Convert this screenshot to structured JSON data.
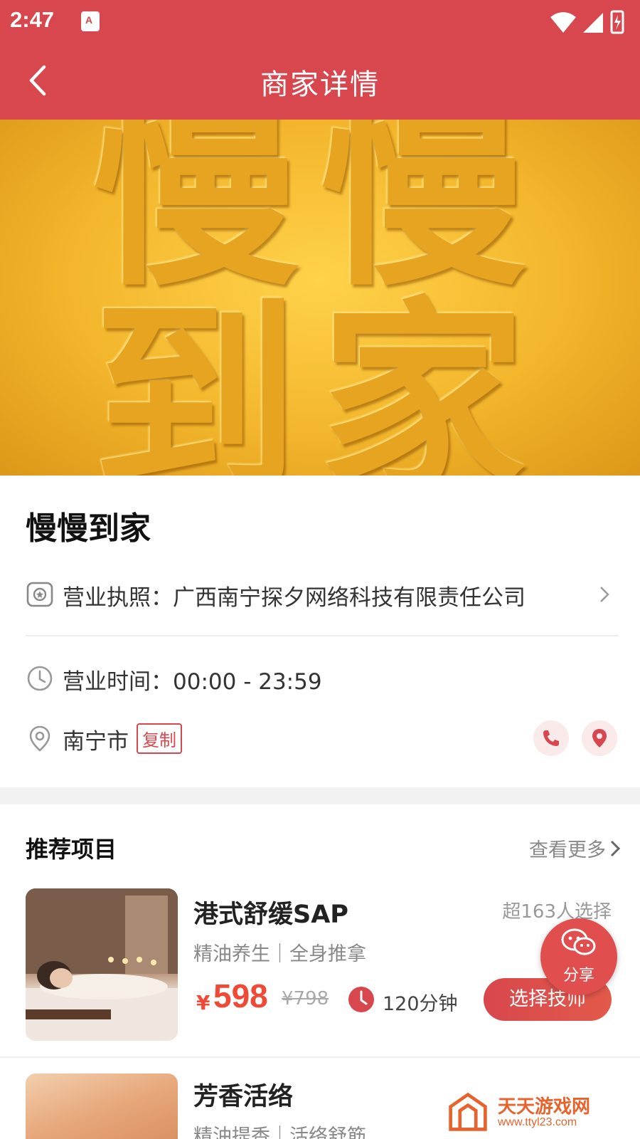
{
  "status_bar": {
    "time": "2:47",
    "notif_icon": "A"
  },
  "header": {
    "title": "商家详情"
  },
  "banner": {
    "text": "慢慢到家"
  },
  "store": {
    "name": "慢慢到家",
    "license_label": "营业执照：广西南宁探夕网络科技有限责任公司",
    "hours_label": "营业时间：00:00 - 23:59",
    "city": "南宁市",
    "copy": "复制"
  },
  "recommend": {
    "title": "推荐项目",
    "see_more": "查看更多",
    "items": [
      {
        "name": "港式舒缓SAP",
        "tags": "精油养生｜全身推拿",
        "count": "超163人选择",
        "currency": "¥",
        "price": "598",
        "orig_price": "¥798",
        "duration": "120分钟",
        "button": "选择技师"
      },
      {
        "name": "芳香活络",
        "tags": "精油提香｜活络舒筋"
      }
    ]
  },
  "share": {
    "label": "分享"
  },
  "watermark": {
    "title": "天天游戏网",
    "url": "www.ttyl23.com"
  },
  "colors": {
    "brand": "#d8474d",
    "price": "#f04a36"
  }
}
